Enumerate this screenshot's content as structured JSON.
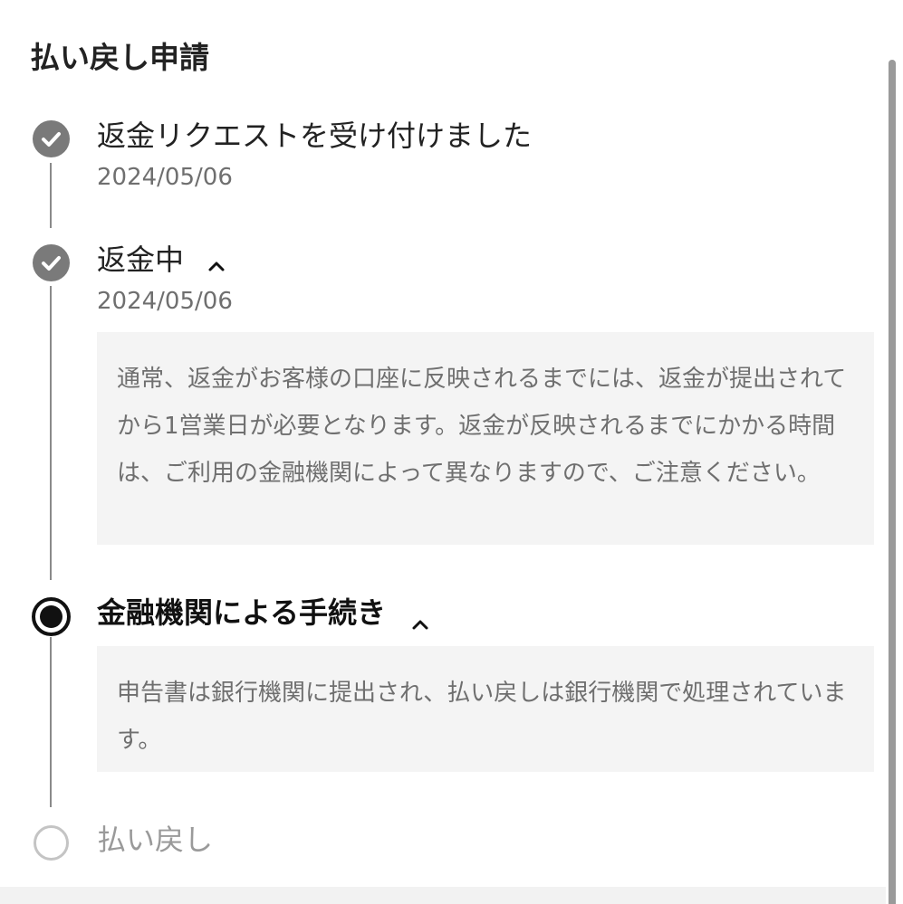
{
  "header": {
    "title": "払い戻し申請"
  },
  "timeline": {
    "steps": [
      {
        "status": "completed",
        "icon": "check-icon",
        "title": "返金リクエストを受け付けました",
        "date": "2024/05/06"
      },
      {
        "status": "completed",
        "icon": "check-icon",
        "title": "返金中",
        "date": "2024/05/06",
        "expanded": true,
        "toggle_icon": "chevron-up-icon",
        "note": "通常、返金がお客様の口座に反映されるまでには、返金が提出されてから1営業日が必要となります。返金が反映されるまでにかかる時間は、ご利用の金融機関によって異なりますので、ご注意ください。"
      },
      {
        "status": "current",
        "icon": "radio-filled-icon",
        "title": "金融機関による手続き",
        "expanded": true,
        "toggle_icon": "chevron-up-icon",
        "note": "申告書は銀行機関に提出され、払い戻しは銀行機関で処理されています。"
      },
      {
        "status": "pending",
        "icon": "radio-empty-icon",
        "title": "払い戻し"
      }
    ]
  },
  "colors": {
    "completed_marker": "#7a7a7a",
    "current_marker": "#111111",
    "pending_marker": "#c4c4c4",
    "note_background": "#f4f4f4",
    "muted_text": "#6f6f6f"
  }
}
